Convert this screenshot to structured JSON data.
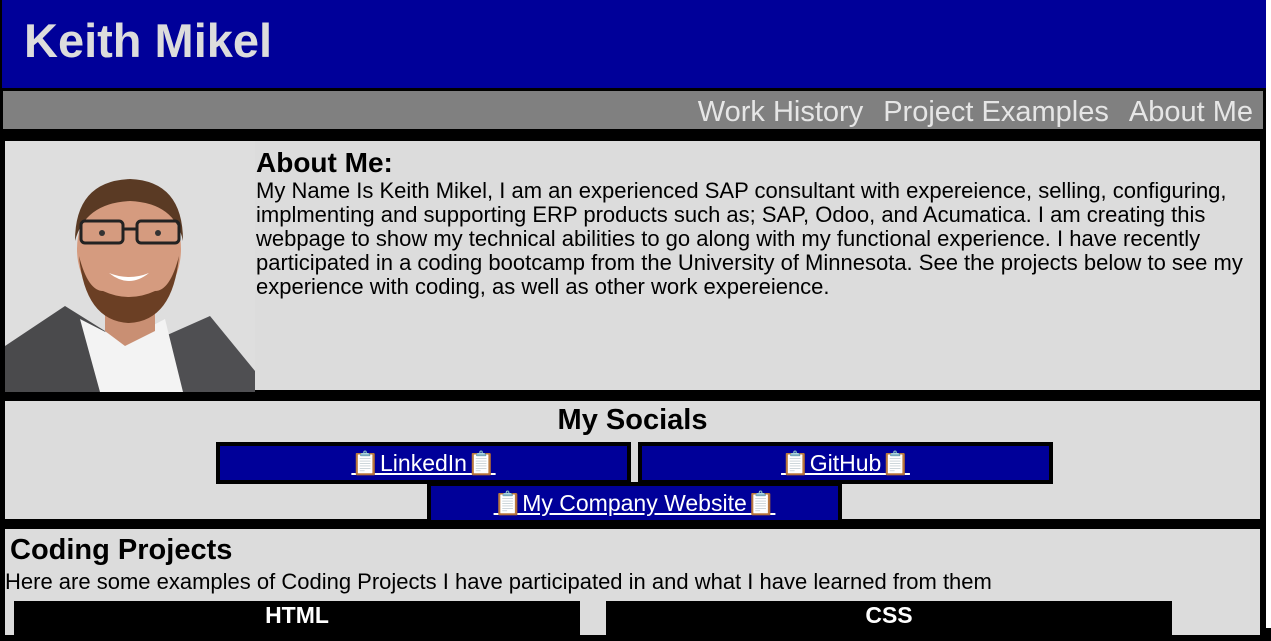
{
  "header": {
    "title": "Keith Mikel"
  },
  "nav": {
    "links": [
      "Work History",
      "Project Examples",
      "About Me"
    ]
  },
  "about": {
    "heading": "About Me:",
    "body": "My Name Is Keith Mikel, I am an experienced SAP consultant with expereience, selling, configuring, implmenting and supporting ERP products such as; SAP, Odoo, and Acumatica. I am creating this webpage to show my technical abilities to go along with my functional experience. I have recently participated in a coding bootcamp from the University of Minnesota. See the projects below to see my experience with coding, as well as other work expereience."
  },
  "socials": {
    "heading": "My Socials",
    "links": {
      "linkedin": "📋LinkedIn📋",
      "github": "📋GitHub📋",
      "company": "📋My Company Website📋"
    }
  },
  "projects": {
    "heading": "Coding Projects",
    "intro": "Here are some examples of Coding Projects I have participated in and what I have learned from them",
    "cards": [
      "HTML",
      "CSS"
    ]
  },
  "colors": {
    "header_bg": "#000099",
    "nav_bg": "#808080",
    "panel_bg": "#dcdcdc"
  }
}
